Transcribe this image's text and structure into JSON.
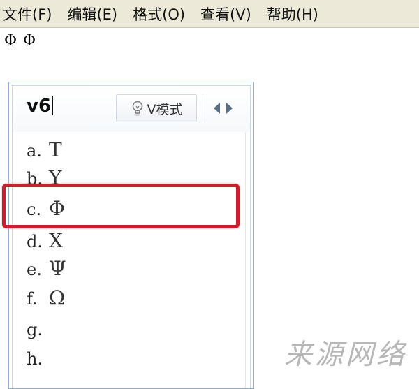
{
  "menubar": {
    "items": [
      {
        "label": "文件(F)"
      },
      {
        "label": "编辑(E)"
      },
      {
        "label": "格式(O)"
      },
      {
        "label": "查看(V)"
      },
      {
        "label": "帮助(H)"
      }
    ]
  },
  "document": {
    "text": "Φ Φ"
  },
  "ime": {
    "input_value": "v6",
    "mode_label": "V模式",
    "candidates": [
      {
        "key": "a.",
        "symbol": "Τ"
      },
      {
        "key": "b.",
        "symbol": "Υ"
      },
      {
        "key": "c.",
        "symbol": "Φ"
      },
      {
        "key": "d.",
        "symbol": "Χ"
      },
      {
        "key": "e.",
        "symbol": "Ψ"
      },
      {
        "key": "f.",
        "symbol": "Ω"
      },
      {
        "key": "g.",
        "symbol": ""
      },
      {
        "key": "h.",
        "symbol": ""
      }
    ],
    "highlight_color": "#c8202e",
    "border_color": "#93b4d6"
  },
  "watermark": {
    "text": "来源网络"
  }
}
